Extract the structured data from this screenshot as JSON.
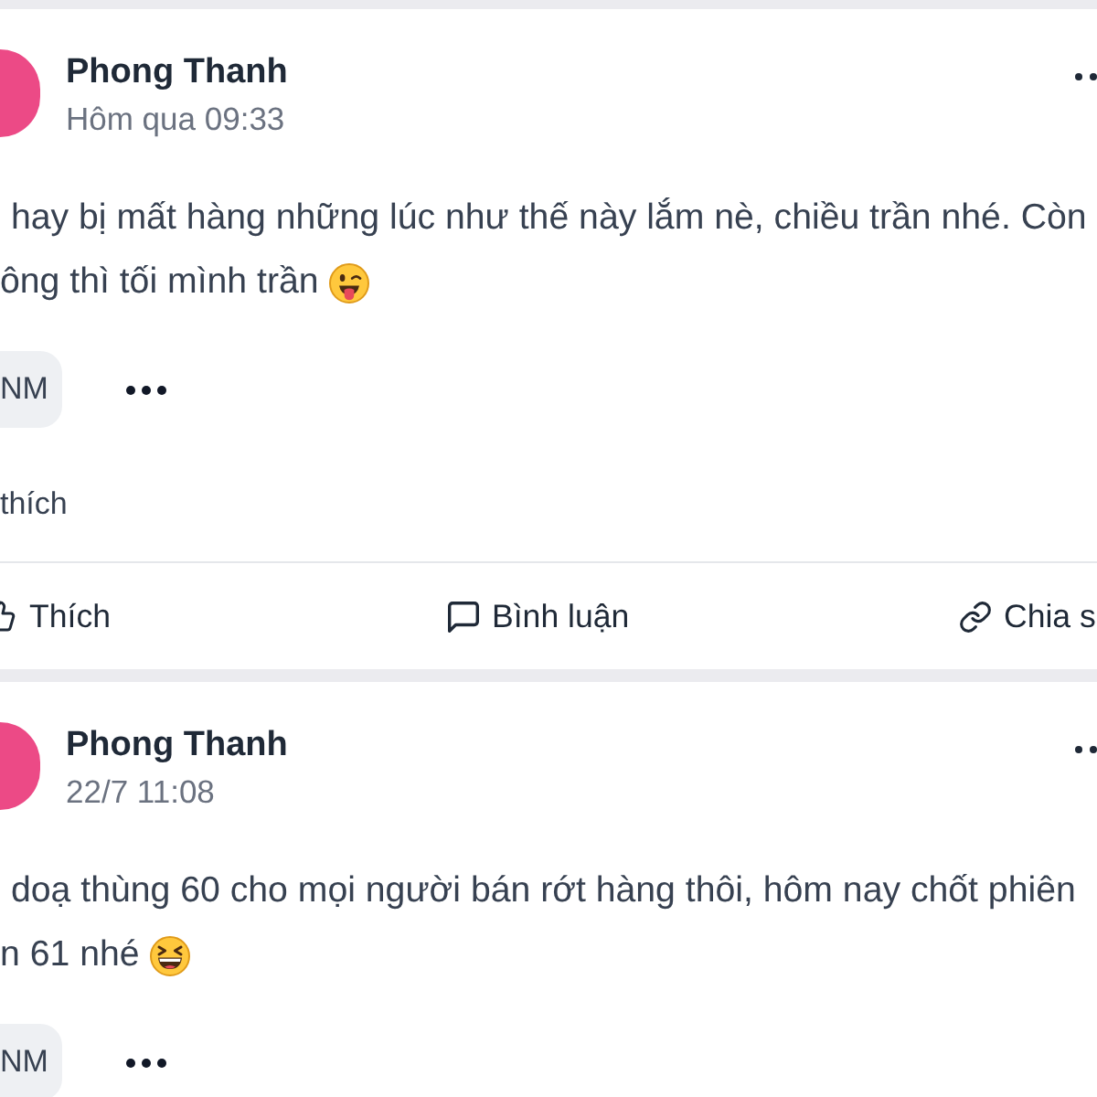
{
  "posts": [
    {
      "author": "Phong Thanh",
      "time": "Hôm qua 09:33",
      "text_lines": [
        {
          "kind": "plain",
          "text": "hay bị mất hàng những lúc như thế này lắm nè, chiều trần nhé. Còn"
        },
        {
          "kind": "tongue",
          "text": "ông thì tối mình trần"
        }
      ],
      "tag": "NM",
      "likes": "thích",
      "actions": [
        {
          "kind": "like",
          "label": "Thích"
        },
        {
          "kind": "comment",
          "label": "Bình luận"
        },
        {
          "kind": "share",
          "label": "Chia s"
        }
      ]
    },
    {
      "author": "Phong Thanh",
      "time": "22/7 11:08",
      "text_lines": [
        {
          "kind": "plain",
          "text": "doạ thùng 60 cho mọi người bán rớt hàng thôi, hôm nay chốt phiên"
        },
        {
          "kind": "laugh",
          "text": "n 61 nhé"
        }
      ],
      "tag": "NM"
    }
  ]
}
